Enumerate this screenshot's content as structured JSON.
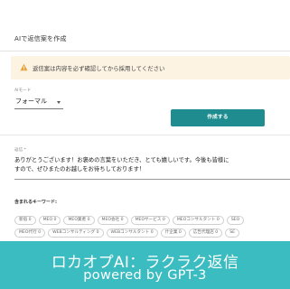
{
  "header": {
    "title": "AIで返信案を作成"
  },
  "alert": {
    "message": "返信案は内容を必ず確認してから採用してください"
  },
  "mode": {
    "label": "AIモード",
    "value": "フォーマル"
  },
  "generate_button": {
    "label": "作成する"
  },
  "reply": {
    "label": "返信 *",
    "text": "ありがとうございます！お褒めの言葉をいただき、とても嬉しいです。今後も皆様に\nすので、ぜひまたのお越しをお待ちしております！"
  },
  "keywords": {
    "label": "含まれるキーワード:",
    "row1": [
      "新宿 0",
      "MEO 0",
      "MEO業者 0",
      "MEO会社 0",
      "MEOサービス 0",
      "MEOコンサルタント 0",
      "SEO"
    ],
    "row2": [
      "MEO代行 0",
      "WEBコンサルティング 0",
      "WEBコンサルタント 0",
      "什企業 0",
      "広告代理店 0",
      "SE"
    ]
  },
  "banner": {
    "line1": "ロカオプAI：ラクラク返信",
    "line2": "powered by GPT-3"
  },
  "colors": {
    "accent": "#1f8d8f",
    "banner": "#3bbcc0",
    "alert_bg": "#fdf3e3",
    "warning": "#e8a33a"
  }
}
